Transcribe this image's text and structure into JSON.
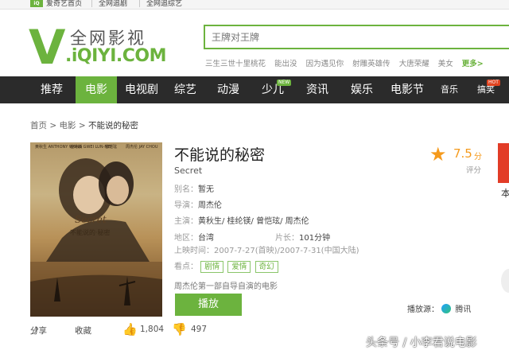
{
  "topbar": {
    "site": "爱奇艺首页",
    "link1": "全网追剧",
    "link2": "全网追综艺"
  },
  "header": {
    "logo_cn": "全网影视",
    "logo_v": "V",
    "logo_en": ".iQIYI.COM",
    "search_placeholder": "王牌对王牌",
    "hotwords": [
      "三生三世十里桃花",
      "能出没",
      "因为遇见你",
      "射雕英雄传",
      "大唐荣耀",
      "美女"
    ],
    "more": "更多>"
  },
  "nav": {
    "items": [
      "推荐",
      "电影",
      "电视剧",
      "综艺",
      "动漫",
      "少儿",
      "资讯",
      "娱乐",
      "电影节",
      "音乐",
      "搞笑"
    ],
    "active": "电影",
    "badge_new": "NEW",
    "badge_hot": "HOT"
  },
  "breadcrumb": {
    "home": "首页",
    "sep": ">",
    "section": "电影",
    "current": "不能说的秘密"
  },
  "movie": {
    "title": "不能说的秘密",
    "subtitle": "Secret",
    "alias_label": "别名：",
    "alias": "暂无",
    "director_label": "导演：",
    "director": "周杰伦",
    "cast_label": "主演：",
    "cast": "黄秋生/ 桂纶镁/ 曾恺玹/ 周杰伦",
    "region_label": "地区：",
    "region": "台湾",
    "length_label": "片长：",
    "length": "101分钟",
    "release_label": "上映时间：",
    "release": "2007-7-27(首映)/2007-7-31(中国大陆)",
    "tags_label": "看点：",
    "tags": [
      "剧情",
      "爱情",
      "奇幻"
    ],
    "description": "周杰伦第一部自导自演的电影",
    "play": "播放"
  },
  "rating": {
    "score": "7.5",
    "unit": "分",
    "label": "评分"
  },
  "source": {
    "label": "播放源：",
    "name": "腾讯"
  },
  "actions": {
    "share": "分享",
    "fav": "收藏",
    "likes": "1,804",
    "dislikes": "497"
  },
  "poster": {
    "credit1": "黄秋生 ANTHONY WONG",
    "credit2": "桂纶镁 GWEI LUN-MEI",
    "credit3": "曾恺玹",
    "credit4": "周杰伦 JAY CHOU",
    "title_en": "Secret",
    "title_cn": "不能说的·秘密"
  },
  "watermark": "头条号 / 小李君说电影",
  "side": {
    "text": "本"
  },
  "colors": {
    "brand_green": "#6cb33e",
    "nav_bg": "#2b2b2b",
    "rating": "#f59a1c"
  }
}
